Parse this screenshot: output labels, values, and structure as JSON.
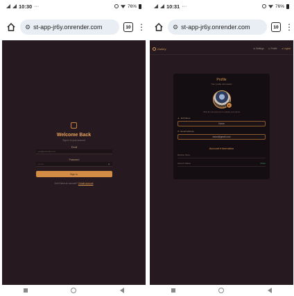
{
  "left": {
    "status": {
      "time": "10:30",
      "battery": "76%"
    },
    "url": "st-app-jr6y.onrender.com",
    "tab_count": "10",
    "login": {
      "title": "Welcome Back",
      "subtitle": "Sign in to your account",
      "email_label": "Email",
      "email_placeholder": "you@example.com",
      "password_label": "Password",
      "password_placeholder": "••••••••",
      "button": "Sign In",
      "footer_text": "Don't have an account?",
      "footer_link": "Create account"
    }
  },
  "right": {
    "status": {
      "time": "10:31",
      "battery": "76%"
    },
    "url": "st-app-jr6y.onrender.com",
    "tab_count": "10",
    "nav": {
      "brand": "Gallery",
      "settings": "Settings",
      "profile": "Profile",
      "logout": "Logout"
    },
    "profile": {
      "title": "Profile",
      "subtitle": "Your profile information",
      "hint": "Click the camera icon to update your photo",
      "fullname_label": "Full Name",
      "fullname_value": "Karan",
      "email_label": "Email Address",
      "email_value": "karan@gmail.com",
      "account_heading": "Account Information",
      "rows": [
        {
          "label": "Member Since",
          "value": ""
        },
        {
          "label": "Account Status",
          "value": "Active"
        }
      ]
    }
  },
  "colors": {
    "bg": "#261a20",
    "accent": "#d38c45",
    "active": "#3fa86a"
  },
  "icons": [
    "home-icon",
    "tune-icon",
    "tabs-icon",
    "menu-icon",
    "camera-icon",
    "user-icon",
    "mail-icon",
    "logout-icon"
  ]
}
